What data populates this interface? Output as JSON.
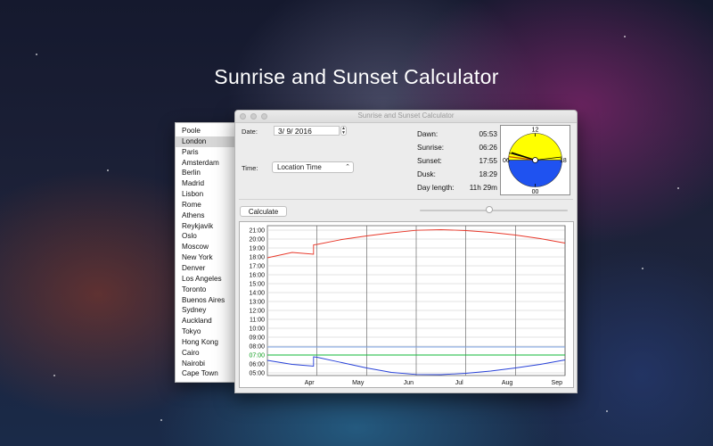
{
  "hero": {
    "title": "Sunrise and Sunset Calculator"
  },
  "window": {
    "title": "Sunrise and Sunset Calculator"
  },
  "cities": [
    "Poole",
    "London",
    "Paris",
    "Amsterdam",
    "Berlin",
    "Madrid",
    "Lisbon",
    "Rome",
    "Athens",
    "Reykjavik",
    "Oslo",
    "Moscow",
    "New York",
    "Denver",
    "Los Angeles",
    "Toronto",
    "Buenos Aires",
    "Sydney",
    "Auckland",
    "Tokyo",
    "Hong Kong",
    "Cairo",
    "Nairobi",
    "Cape Town"
  ],
  "selected_city": "London",
  "form": {
    "date_label": "Date:",
    "date_value": "3/  9/ 2016",
    "time_label": "Time:",
    "time_value": "Location Time"
  },
  "info": {
    "dawn_label": "Dawn:",
    "dawn_value": "05:53",
    "sunrise_label": "Sunrise:",
    "sunrise_value": "06:26",
    "sunset_label": "Sunset:",
    "sunset_value": "17:55",
    "dusk_label": "Dusk:",
    "dusk_value": "18:29",
    "daylength_label": "Day length:",
    "daylength_value": "11h 29m"
  },
  "clock": {
    "label_top": "12",
    "label_left": "06",
    "label_right": "18",
    "label_bottom": "00",
    "day_color": "#ffff00",
    "night_color": "#1f52f0"
  },
  "buttons": {
    "calculate": "Calculate"
  },
  "slider": {
    "value": 0.47
  },
  "chart_data": {
    "type": "line",
    "y_ticks": [
      "21:00",
      "20:00",
      "19:00",
      "18:00",
      "17:00",
      "16:00",
      "15:00",
      "14:00",
      "13:00",
      "12:00",
      "11:00",
      "10:00",
      "09:00",
      "08:00",
      "07:00",
      "06:00",
      "05:00"
    ],
    "highlight_tick": "07:00",
    "x_ticks": [
      "Apr",
      "May",
      "Jun",
      "Jul",
      "Aug",
      "Sep"
    ],
    "ylim": [
      4.7,
      21.5
    ],
    "xlim": [
      0,
      6
    ],
    "grid": true,
    "series": [
      {
        "color": "#e8382a",
        "x": [
          0,
          0.5,
          1,
          1.5,
          2,
          2.5,
          3,
          3.5,
          4,
          4.5,
          5,
          5.5,
          6
        ],
        "y": [
          17.9,
          18.5,
          19.4,
          19.95,
          20.35,
          20.7,
          20.98,
          21.05,
          20.95,
          20.75,
          20.45,
          20.05,
          19.55
        ],
        "step": {
          "x": 0.93,
          "from": 18.3,
          "to": 19.35
        }
      },
      {
        "color": "#2741d8",
        "x": [
          0,
          0.5,
          1,
          1.5,
          2,
          2.5,
          3,
          3.5,
          4,
          4.5,
          5,
          5.5,
          6
        ],
        "y": [
          6.4,
          5.95,
          6.75,
          6.15,
          5.55,
          5.05,
          4.82,
          4.8,
          4.95,
          5.2,
          5.55,
          5.95,
          6.45
        ],
        "step": {
          "x": 0.93,
          "from": 5.75,
          "to": 6.8
        }
      },
      {
        "color": "#12b83a",
        "x": [
          0,
          6
        ],
        "y": [
          7.0,
          7.0
        ]
      },
      {
        "color": "#7ba2e6",
        "x": [
          0,
          6
        ],
        "y": [
          7.9,
          7.9
        ]
      }
    ]
  }
}
